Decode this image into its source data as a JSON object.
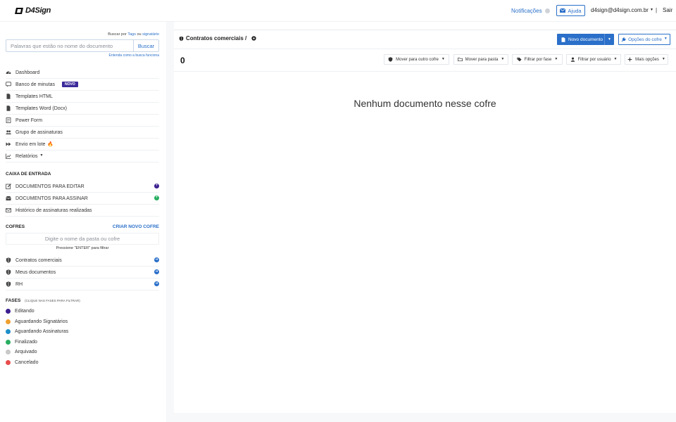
{
  "header": {
    "logo_text": "D4Sign",
    "notifications_label": "Notificações",
    "help_label": "Ajuda",
    "user_email": "d4sign@d4sign.com.br",
    "separator": "|",
    "logout_label": "Sair"
  },
  "search": {
    "hint_prefix": "Buscar por",
    "hint_tags": "Tags",
    "hint_or": "ou",
    "hint_signer": "signatário",
    "placeholder": "Palavras que estão no nome do documento",
    "button_label": "Buscar",
    "help_link": "Entenda como a busca funciona"
  },
  "nav": {
    "items": [
      {
        "label": "Dashboard",
        "icon": "dashboard-icon"
      },
      {
        "label": "Banco de minutas",
        "icon": "comment-icon",
        "badge": "NOVO"
      },
      {
        "label": "Templates HTML",
        "icon": "file-icon"
      },
      {
        "label": "Templates Word (Docx)",
        "icon": "file-icon"
      },
      {
        "label": "Power Form",
        "icon": "form-icon"
      },
      {
        "label": "Grupo de assinaturas",
        "icon": "users-icon"
      },
      {
        "label": "Envio em lote",
        "icon": "send-icon",
        "extra": "🔥"
      },
      {
        "label": "Relatórios",
        "icon": "chart-icon",
        "caret": "▼"
      }
    ]
  },
  "inbox": {
    "title": "CAIXA DE ENTRADA",
    "items": [
      {
        "label": "DOCUMENTOS PARA EDITAR",
        "icon": "edit-icon"
      },
      {
        "label": "DOCUMENTOS PARA ASSINAR",
        "icon": "inbox-icon"
      },
      {
        "label": "Histórico de assinaturas realizadas",
        "icon": "envelope-icon"
      }
    ]
  },
  "vaults": {
    "title": "COFRES",
    "create_link": "CRIAR NOVO COFRE",
    "filter_placeholder": "Digite o nome da pasta ou cofre",
    "filter_hint": "Pressione \"ENTER\" para filtrar",
    "items": [
      {
        "label": "Contratos comerciais"
      },
      {
        "label": "Meus documentos"
      },
      {
        "label": "RH"
      }
    ]
  },
  "phases": {
    "title": "FASES",
    "subtitle": "(CLIQUE NAS FASES PARA FILTRAR)",
    "items": [
      {
        "label": "Editando",
        "color": "#3b1f8f"
      },
      {
        "label": "Aguardando Signatários",
        "color": "#f0a030"
      },
      {
        "label": "Aguardando Assinaturas",
        "color": "#1e8fc9"
      },
      {
        "label": "Finalizado",
        "color": "#27ae60"
      },
      {
        "label": "Arquivado",
        "color": "#c8c8c8"
      },
      {
        "label": "Cancelado",
        "color": "#e84c4c"
      }
    ]
  },
  "main": {
    "breadcrumb": "Contratos comerciais /",
    "new_document_label": "Novo documento",
    "vault_options_label": "Opções do cofre",
    "count": "0",
    "toolbar": {
      "move_vault": "Mover para outro cofre",
      "move_folder": "Mover para pasta",
      "filter_phase": "Filtrar por fase",
      "filter_user": "Filtrar por usuário",
      "more_options": "Mais opções"
    },
    "empty_message": "Nenhum documento nesse cofre"
  }
}
